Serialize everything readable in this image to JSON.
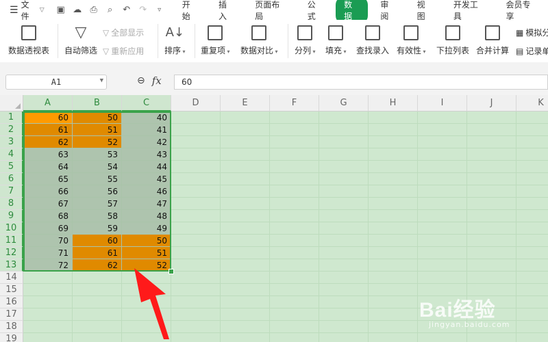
{
  "menubar": {
    "file_label": "文件",
    "tabs": [
      {
        "label": "开始",
        "active": false
      },
      {
        "label": "插入",
        "active": false
      },
      {
        "label": "页面布局",
        "active": false
      },
      {
        "label": "公式",
        "active": false
      },
      {
        "label": "数据",
        "active": true
      },
      {
        "label": "审阅",
        "active": false
      },
      {
        "label": "视图",
        "active": false
      },
      {
        "label": "开发工具",
        "active": false
      },
      {
        "label": "会员专享",
        "active": false
      }
    ]
  },
  "ribbon": {
    "pivot": "数据透视表",
    "autofilter": "自动筛选",
    "show_all": "全部显示",
    "reapply": "重新应用",
    "sort": "排序",
    "duplicates": "重复项",
    "compare": "数据对比",
    "split": "分列",
    "fill": "填充",
    "find_entry": "查找录入",
    "validity": "有效性",
    "dropdown_list": "下拉列表",
    "consolidate": "合并计算",
    "simulate": "模拟分",
    "record": "记录单"
  },
  "formula_bar": {
    "cell_ref": "A1",
    "formula": "60"
  },
  "sheet": {
    "columns": [
      "A",
      "B",
      "C",
      "D",
      "E",
      "F",
      "G",
      "H",
      "I",
      "J",
      "K"
    ],
    "rows": [
      "1",
      "2",
      "3",
      "4",
      "5",
      "6",
      "7",
      "8",
      "9",
      "10",
      "11",
      "12",
      "13",
      "14",
      "15",
      "16",
      "17",
      "18",
      "19"
    ],
    "data": [
      [
        "60",
        "50",
        "40"
      ],
      [
        "61",
        "51",
        "41"
      ],
      [
        "62",
        "52",
        "42"
      ],
      [
        "63",
        "53",
        "43"
      ],
      [
        "64",
        "54",
        "44"
      ],
      [
        "65",
        "55",
        "45"
      ],
      [
        "66",
        "56",
        "46"
      ],
      [
        "67",
        "57",
        "47"
      ],
      [
        "68",
        "58",
        "48"
      ],
      [
        "69",
        "59",
        "49"
      ],
      [
        "70",
        "60",
        "50"
      ],
      [
        "71",
        "61",
        "51"
      ],
      [
        "72",
        "62",
        "52"
      ]
    ]
  },
  "colors": {
    "accent": "#1a9c53",
    "highlight_orange": "#e08a00",
    "active_cell_orange": "#ff9a00",
    "selection_fill": "#aec4ae",
    "sheet_bg": "#cfe8cf",
    "arrow": "#ff1a1a"
  },
  "watermark": {
    "brand": "Bai经验",
    "url": "jingyan.baidu.com"
  }
}
